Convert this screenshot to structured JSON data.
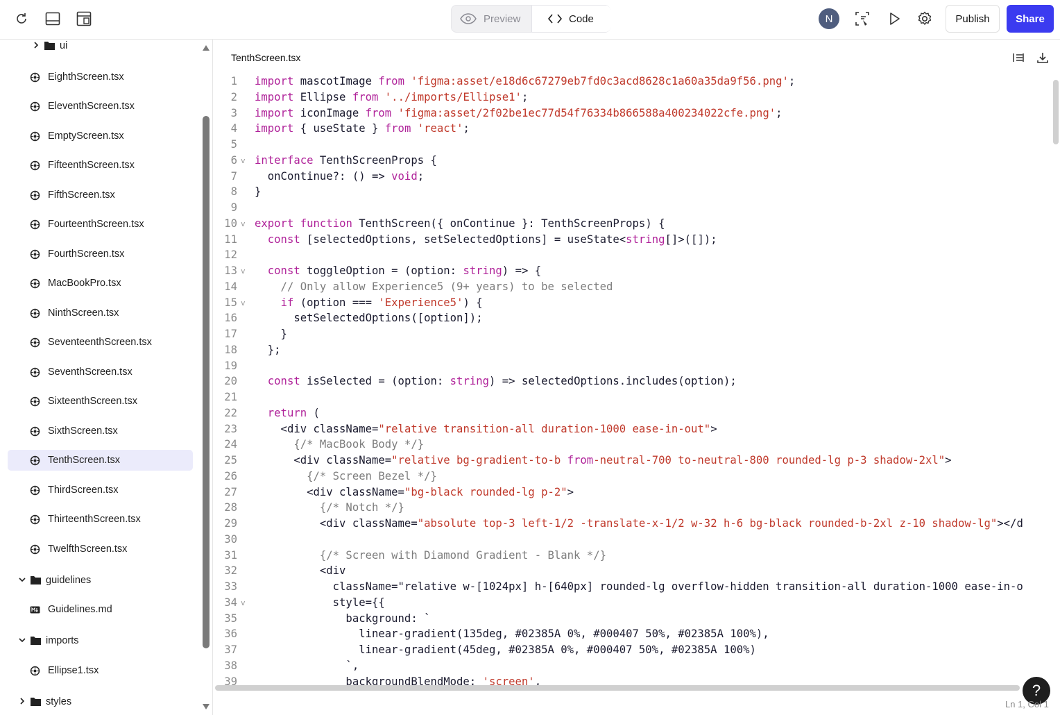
{
  "toolbar": {
    "refresh_icon": "refresh-icon",
    "panel_icon": "panel-icon",
    "layout_icon": "layout-icon",
    "preview_label": "Preview",
    "code_label": "Code",
    "avatar_initial": "N",
    "publish_label": "Publish",
    "share_label": "Share",
    "accent": "#3b3bf0"
  },
  "sidebar": {
    "items": [
      {
        "type": "folder",
        "label": "ui",
        "expanded": false
      },
      {
        "type": "file",
        "label": "EighthScreen.tsx"
      },
      {
        "type": "file",
        "label": "EleventhScreen.tsx"
      },
      {
        "type": "file",
        "label": "EmptyScreen.tsx"
      },
      {
        "type": "file",
        "label": "FifteenthScreen.tsx"
      },
      {
        "type": "file",
        "label": "FifthScreen.tsx"
      },
      {
        "type": "file",
        "label": "FourteenthScreen.tsx"
      },
      {
        "type": "file",
        "label": "FourthScreen.tsx"
      },
      {
        "type": "file",
        "label": "MacBookPro.tsx"
      },
      {
        "type": "file",
        "label": "NinthScreen.tsx"
      },
      {
        "type": "file",
        "label": "SeventeenthScreen.tsx"
      },
      {
        "type": "file",
        "label": "SeventhScreen.tsx"
      },
      {
        "type": "file",
        "label": "SixteenthScreen.tsx"
      },
      {
        "type": "file",
        "label": "SixthScreen.tsx"
      },
      {
        "type": "file",
        "label": "TenthScreen.tsx",
        "selected": true
      },
      {
        "type": "file",
        "label": "ThirdScreen.tsx"
      },
      {
        "type": "file",
        "label": "ThirteenthScreen.tsx"
      },
      {
        "type": "file",
        "label": "TwelfthScreen.tsx"
      },
      {
        "type": "folder",
        "label": "guidelines",
        "expanded": true
      },
      {
        "type": "md",
        "label": "Guidelines.md"
      },
      {
        "type": "folder",
        "label": "imports",
        "expanded": true
      },
      {
        "type": "file",
        "label": "Ellipse1.tsx"
      },
      {
        "type": "folder",
        "label": "styles",
        "expanded": false
      }
    ]
  },
  "editor": {
    "filename": "TenthScreen.tsx",
    "status": "Ln 1, Col 1",
    "help_label": "?",
    "lines": [
      {
        "n": "1",
        "fold": "",
        "text": "import mascotImage from 'figma:asset/e18d6c67279eb7fd0c3acd8628c1a60a35da9f56.png';"
      },
      {
        "n": "2",
        "fold": "",
        "text": "import Ellipse from '../imports/Ellipse1';"
      },
      {
        "n": "3",
        "fold": "",
        "text": "import iconImage from 'figma:asset/2f02be1ec77d54f76334b866588a400234022cfe.png';"
      },
      {
        "n": "4",
        "fold": "",
        "text": "import { useState } from 'react';"
      },
      {
        "n": "5",
        "fold": "",
        "text": ""
      },
      {
        "n": "6",
        "fold": "v",
        "text": "interface TenthScreenProps {"
      },
      {
        "n": "7",
        "fold": "",
        "text": "  onContinue?: () => void;"
      },
      {
        "n": "8",
        "fold": "",
        "text": "}"
      },
      {
        "n": "9",
        "fold": "",
        "text": ""
      },
      {
        "n": "10",
        "fold": "v",
        "text": "export function TenthScreen({ onContinue }: TenthScreenProps) {"
      },
      {
        "n": "11",
        "fold": "",
        "text": "  const [selectedOptions, setSelectedOptions] = useState<string[]>([]);"
      },
      {
        "n": "12",
        "fold": "",
        "text": ""
      },
      {
        "n": "13",
        "fold": "v",
        "text": "  const toggleOption = (option: string) => {"
      },
      {
        "n": "14",
        "fold": "",
        "text": "    // Only allow Experience5 (9+ years) to be selected"
      },
      {
        "n": "15",
        "fold": "v",
        "text": "    if (option === 'Experience5') {"
      },
      {
        "n": "16",
        "fold": "",
        "text": "      setSelectedOptions([option]);"
      },
      {
        "n": "17",
        "fold": "",
        "text": "    }"
      },
      {
        "n": "18",
        "fold": "",
        "text": "  };"
      },
      {
        "n": "19",
        "fold": "",
        "text": ""
      },
      {
        "n": "20",
        "fold": "",
        "text": "  const isSelected = (option: string) => selectedOptions.includes(option);"
      },
      {
        "n": "21",
        "fold": "",
        "text": ""
      },
      {
        "n": "22",
        "fold": "",
        "text": "  return ("
      },
      {
        "n": "23",
        "fold": "",
        "text": "    <div className=\"relative transition-all duration-1000 ease-in-out\">"
      },
      {
        "n": "24",
        "fold": "",
        "text": "      {/* MacBook Body */}"
      },
      {
        "n": "25",
        "fold": "",
        "text": "      <div className=\"relative bg-gradient-to-b from-neutral-700 to-neutral-800 rounded-lg p-3 shadow-2xl\">"
      },
      {
        "n": "26",
        "fold": "",
        "text": "        {/* Screen Bezel */}"
      },
      {
        "n": "27",
        "fold": "",
        "text": "        <div className=\"bg-black rounded-lg p-2\">"
      },
      {
        "n": "28",
        "fold": "",
        "text": "          {/* Notch */}"
      },
      {
        "n": "29",
        "fold": "",
        "text": "          <div className=\"absolute top-3 left-1/2 -translate-x-1/2 w-32 h-6 bg-black rounded-b-2xl z-10 shadow-lg\"></d"
      },
      {
        "n": "30",
        "fold": "",
        "text": ""
      },
      {
        "n": "31",
        "fold": "",
        "text": "          {/* Screen with Diamond Gradient - Blank */}"
      },
      {
        "n": "32",
        "fold": "",
        "text": "          <div"
      },
      {
        "n": "33",
        "fold": "",
        "text": "            className=\"relative w-[1024px] h-[640px] rounded-lg overflow-hidden transition-all duration-1000 ease-in-o"
      },
      {
        "n": "34",
        "fold": "v",
        "text": "            style={{"
      },
      {
        "n": "35",
        "fold": "",
        "text": "              background: `"
      },
      {
        "n": "36",
        "fold": "",
        "text": "                linear-gradient(135deg, #02385A 0%, #000407 50%, #02385A 100%),"
      },
      {
        "n": "37",
        "fold": "",
        "text": "                linear-gradient(45deg, #02385A 0%, #000407 50%, #02385A 100%)"
      },
      {
        "n": "38",
        "fold": "",
        "text": "              `,"
      },
      {
        "n": "39",
        "fold": "",
        "text": "              backgroundBlendMode: 'screen',"
      }
    ]
  }
}
